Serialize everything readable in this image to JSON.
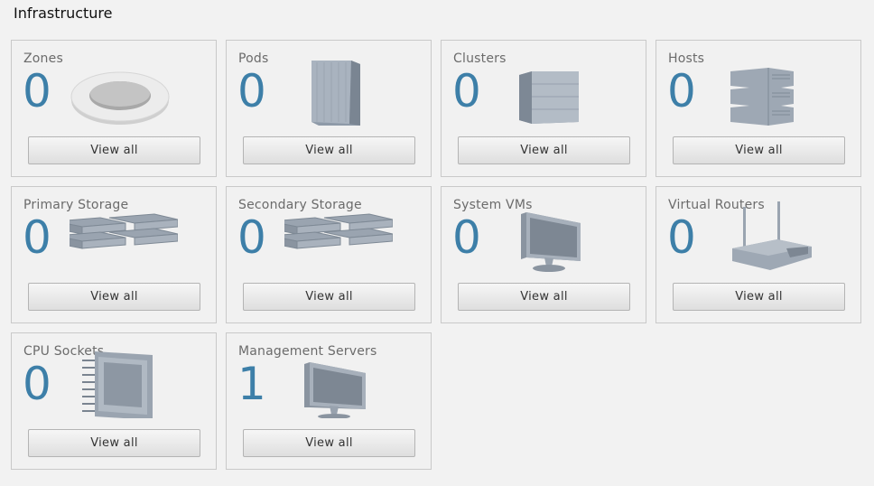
{
  "page": {
    "title": "Infrastructure"
  },
  "cards": [
    {
      "title": "Zones",
      "count": "0",
      "button": "View all",
      "icon": "zone-icon"
    },
    {
      "title": "Pods",
      "count": "0",
      "button": "View all",
      "icon": "pod-icon"
    },
    {
      "title": "Clusters",
      "count": "0",
      "button": "View all",
      "icon": "cluster-icon"
    },
    {
      "title": "Hosts",
      "count": "0",
      "button": "View all",
      "icon": "host-icon"
    },
    {
      "title": "Primary Storage",
      "count": "0",
      "button": "View all",
      "icon": "primary-storage-icon"
    },
    {
      "title": "Secondary Storage",
      "count": "0",
      "button": "View all",
      "icon": "secondary-storage-icon"
    },
    {
      "title": "System VMs",
      "count": "0",
      "button": "View all",
      "icon": "system-vm-icon"
    },
    {
      "title": "Virtual Routers",
      "count": "0",
      "button": "View all",
      "icon": "virtual-router-icon"
    },
    {
      "title": "CPU Sockets",
      "count": "0",
      "button": "View all",
      "icon": "cpu-socket-icon"
    },
    {
      "title": "Management Servers",
      "count": "1",
      "button": "View all",
      "icon": "management-server-icon"
    }
  ],
  "colors": {
    "count": "#3d7fa8",
    "background": "#f2f2f2",
    "card_border": "#c9c9c9"
  }
}
